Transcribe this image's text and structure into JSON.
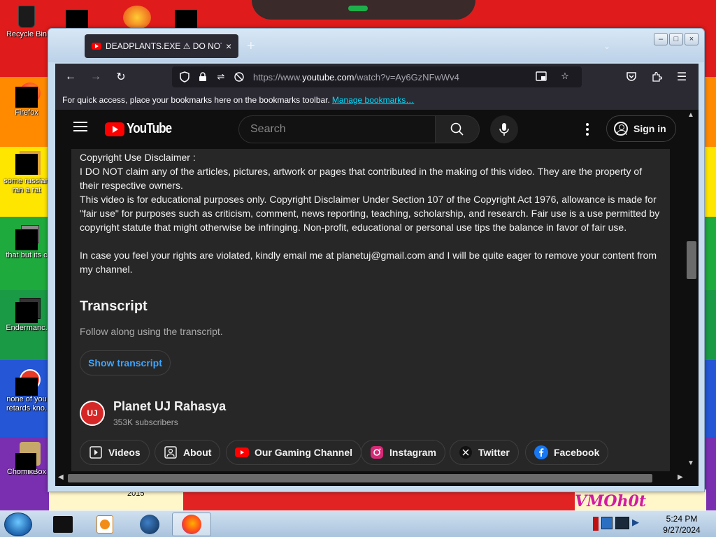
{
  "desktop": {
    "icons": [
      {
        "label": "Recycle Bin",
        "icon": "recycle-bin-icon"
      },
      {
        "label": "Firefox",
        "icon": "firefox-icon"
      },
      {
        "label": "some russian ran a rat",
        "icon": "app-icon"
      },
      {
        "label": "that but its c",
        "icon": "folder-icon"
      },
      {
        "label": "Endermanc.",
        "icon": "app-icon"
      },
      {
        "label": "none of you retards kno.",
        "icon": "app-icon"
      },
      {
        "label": "ChomikBox",
        "icon": "chomikbox-icon"
      }
    ],
    "wallpaper_text": "VMOh0t",
    "wallpaper_year": "2015"
  },
  "window": {
    "tab_title": "DEADPLANTS.EXE ⚠ DO NOT P",
    "tab_close": "×",
    "new_tab": "+",
    "controls": {
      "minimize": "–",
      "maximize": "□",
      "close": "×"
    }
  },
  "toolbar": {
    "url_prefix": "https://www.",
    "url_host": "youtube.com",
    "url_path": "/watch?v=Ay6GzNFwWv4",
    "bookmarks_text": "For quick access, place your bookmarks here on the bookmarks toolbar.",
    "bookmarks_link": "Manage bookmarks…"
  },
  "youtube": {
    "logo_text": "YouTube",
    "search_placeholder": "Search",
    "signin_label": "Sign in",
    "description": {
      "line1": "Copyright Use Disclaimer :",
      "line2": "I DO NOT claim any of the articles, pictures, artwork or pages that contributed in the making of this video. They are the property of their respective owners.",
      "line3": "This video is for educational purposes only. Copyright Disclaimer Under Section 107 of the Copyright Act 1976, allowance is made for \"fair use\" for purposes such as criticism, comment, news reporting, teaching, scholarship, and research. Fair use is a use permitted by copyright statute that might otherwise be infringing. Non-profit, educational or personal use tips the balance in favor of fair use.",
      "line4": "In case you feel your rights are violated, kindly email me at planetuj@gmail.com and I will be quite eager to remove your content from my channel."
    },
    "transcript": {
      "heading": "Transcript",
      "subtitle": "Follow along using the transcript.",
      "button": "Show transcript"
    },
    "channel": {
      "name": "Planet UJ Rahasya",
      "subscribers": "353K subscribers",
      "avatar_text": "UJ"
    },
    "links": [
      {
        "label": "Videos",
        "icon": "video-play-icon"
      },
      {
        "label": "About",
        "icon": "contact-card-icon"
      },
      {
        "label": "Our Gaming Channel",
        "icon": "youtube-icon"
      },
      {
        "label": "Instagram",
        "icon": "instagram-icon"
      },
      {
        "label": "Twitter",
        "icon": "x-twitter-icon"
      },
      {
        "label": "Facebook",
        "icon": "facebook-icon"
      }
    ]
  },
  "taskbar": {
    "time": "5:24 PM",
    "date": "9/27/2024"
  },
  "colors": {
    "youtube_red": "#ff0000",
    "link_blue": "#3ea6ff",
    "bookmark_link": "#00ddff"
  }
}
